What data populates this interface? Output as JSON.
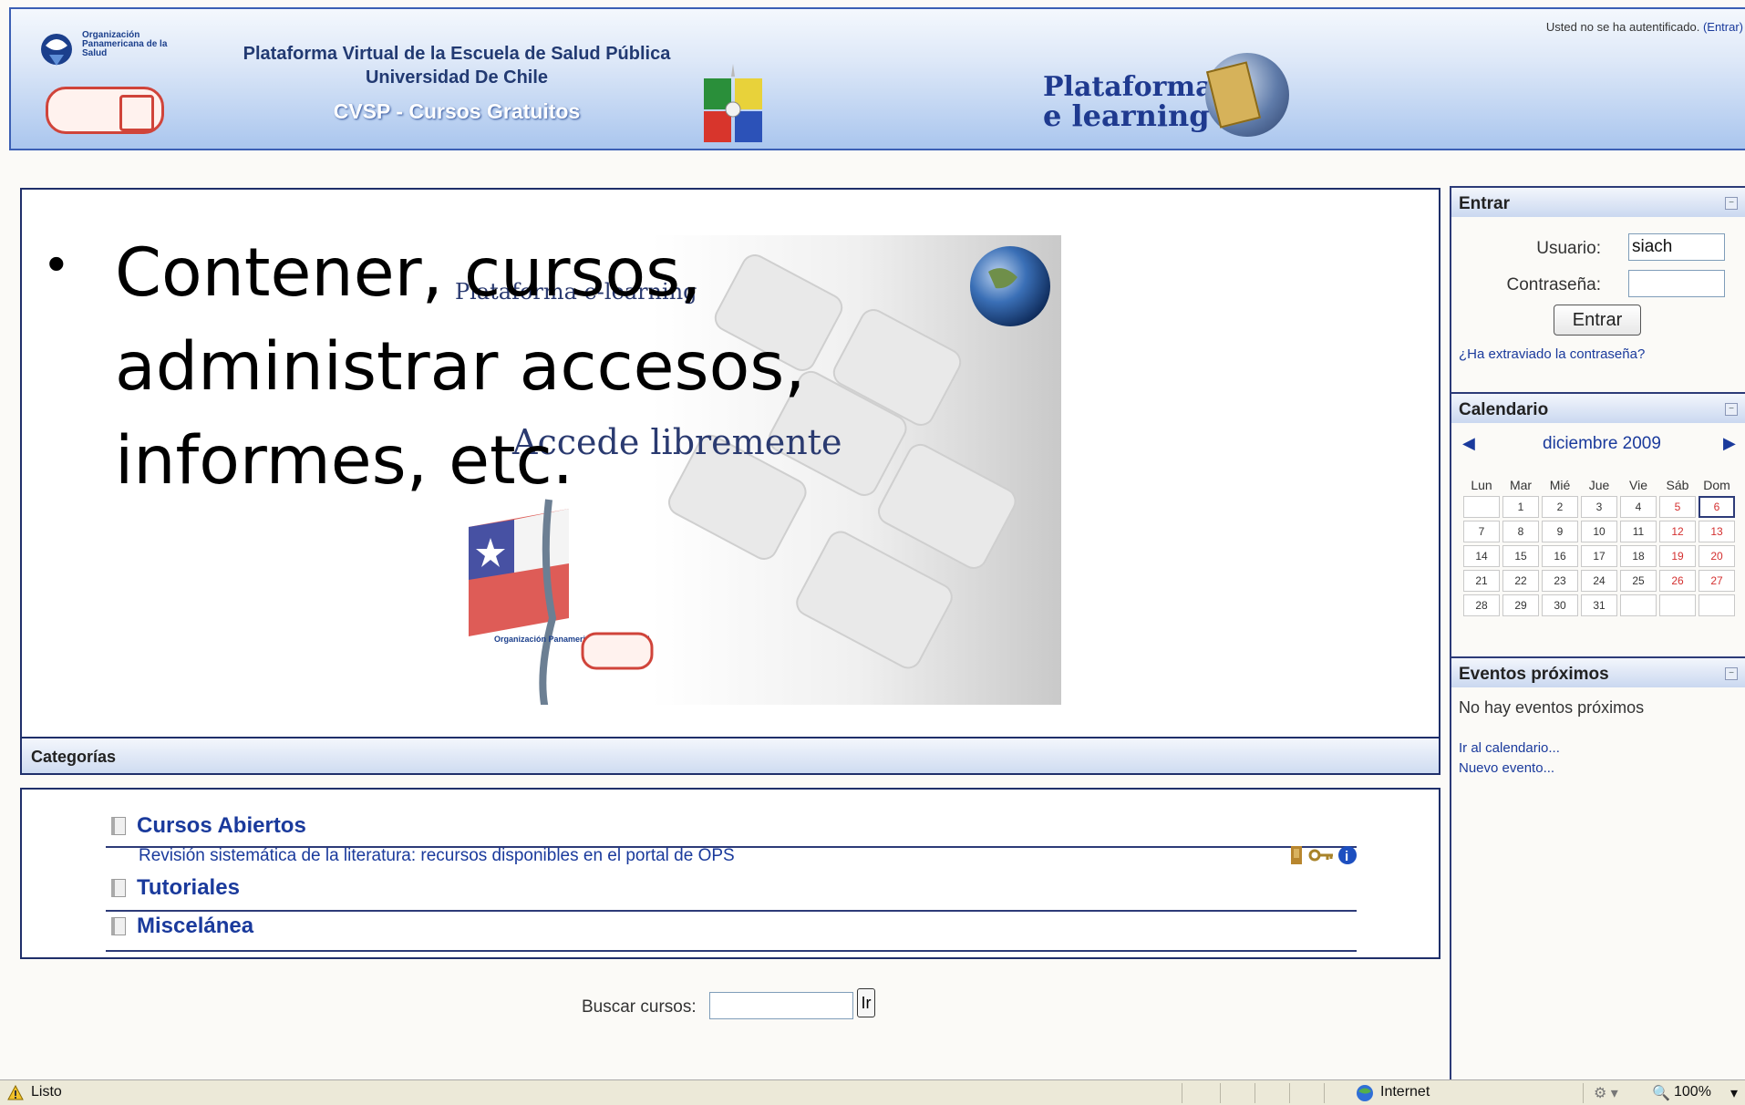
{
  "header": {
    "ops_logo_text": "Organización Panamericana de la Salud",
    "title_line1": "Plataforma Virtual de la Escuela de Salud Pública",
    "title_line2": "Universidad De Chile",
    "title_line3": "CVSP - Cursos Gratuitos",
    "platform_line1": "Plataforma",
    "platform_line2": "e learning",
    "auth_status": "Usted no se ha autentificado.",
    "auth_link": "(Entrar)"
  },
  "main": {
    "bullet_text": "Contener, cursos, administrar accesos, informes, etc.",
    "visual_caption1": "Plataforma e-learning",
    "visual_caption2": "Accede libremente",
    "visual_logo_text": "Organización Panamericana de la Salud"
  },
  "categories": {
    "header": "Categorías",
    "items": [
      {
        "label": "Cursos Abiertos"
      },
      {
        "label": "Tutoriales"
      },
      {
        "label": "Miscelánea"
      }
    ],
    "course": "Revisión sistemática de la literatura: recursos disponibles en el portal de OPS"
  },
  "search": {
    "label": "Buscar cursos:",
    "button": "Ir",
    "value": ""
  },
  "login": {
    "title": "Entrar",
    "user_label": "Usuario:",
    "user_value": "siach",
    "password_label": "Contraseña:",
    "button": "Entrar",
    "lost_password": "¿Ha extraviado la contraseña?"
  },
  "calendar": {
    "title": "Calendario",
    "month": "diciembre 2009",
    "days": [
      "Lun",
      "Mar",
      "Mié",
      "Jue",
      "Vie",
      "Sáb",
      "Dom"
    ],
    "weeks": [
      [
        "",
        "1",
        "2",
        "3",
        "4",
        "5",
        "6"
      ],
      [
        "7",
        "8",
        "9",
        "10",
        "11",
        "12",
        "13"
      ],
      [
        "14",
        "15",
        "16",
        "17",
        "18",
        "19",
        "20"
      ],
      [
        "21",
        "22",
        "23",
        "24",
        "25",
        "26",
        "27"
      ],
      [
        "28",
        "29",
        "30",
        "31",
        "",
        "",
        ""
      ]
    ],
    "today": "6"
  },
  "events": {
    "title": "Eventos próximos",
    "none": "No hay eventos próximos",
    "go_calendar": "Ir al calendario...",
    "new_event": "Nuevo evento..."
  },
  "statusbar": {
    "status": "Listo",
    "zone": "Internet",
    "zoom": "100%"
  },
  "colors": {
    "accent": "#1a3a9c",
    "header_border": "#3b5fb4",
    "weekend": "#d43030"
  },
  "icons": [
    "door-icon",
    "key-icon",
    "info-icon",
    "folder-icon",
    "globe-icon",
    "warning-icon"
  ]
}
